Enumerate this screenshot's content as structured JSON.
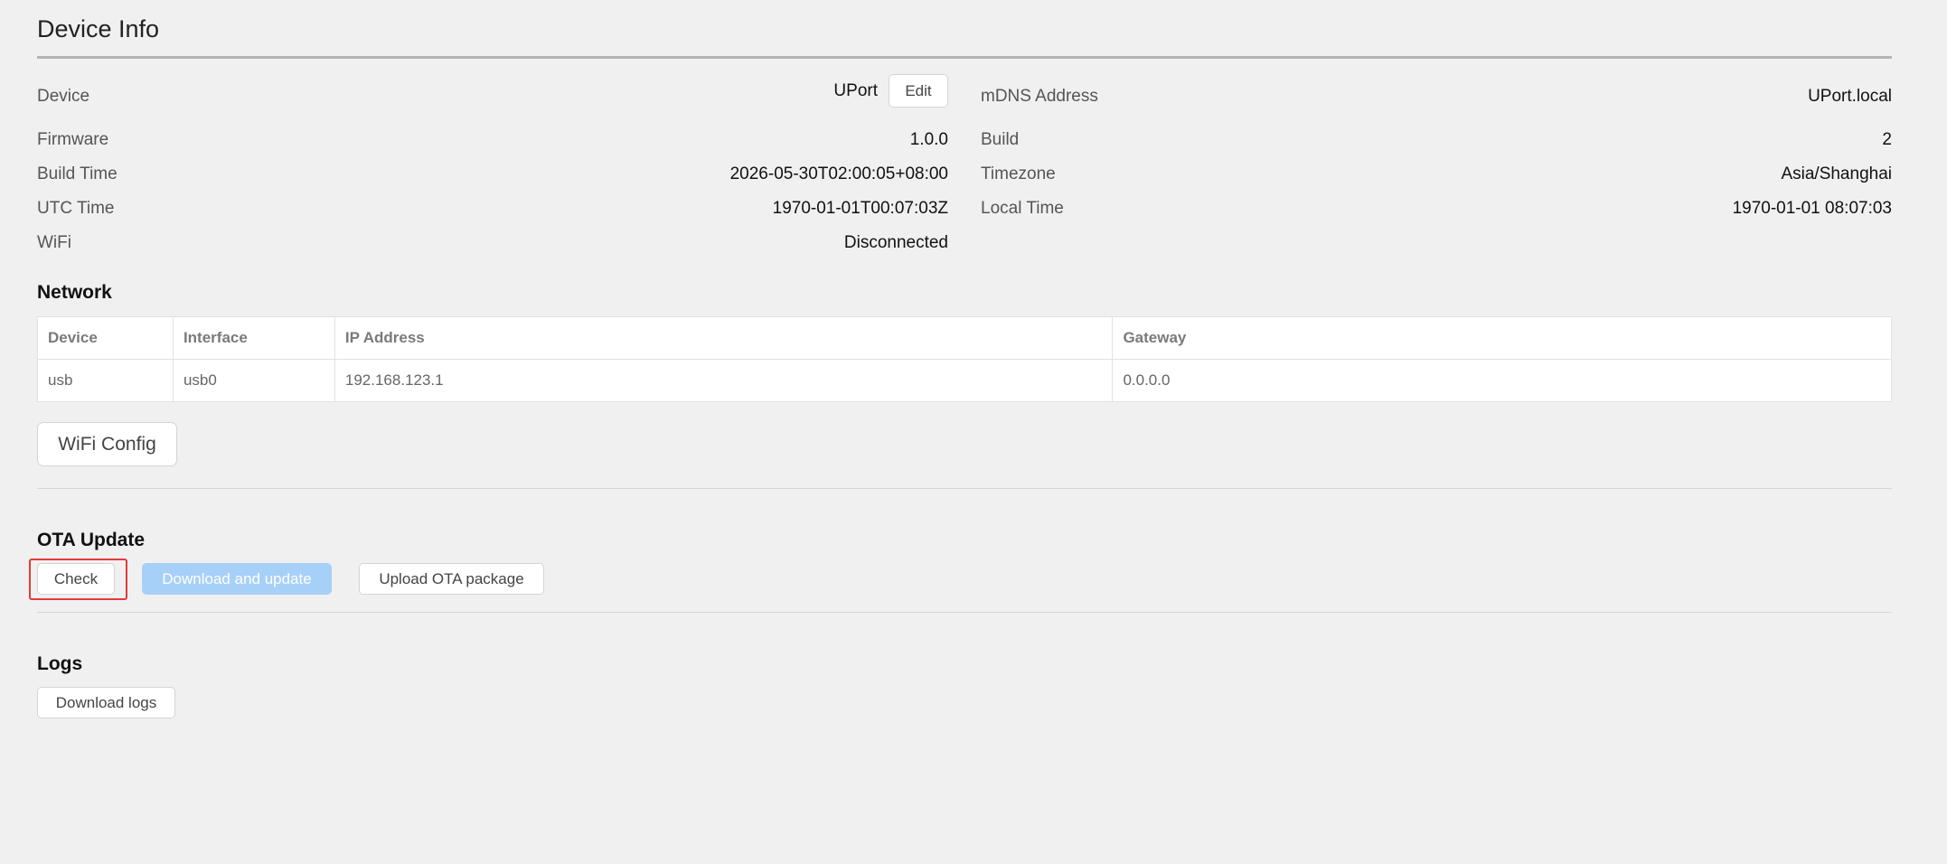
{
  "page": {
    "title": "Device Info"
  },
  "info": {
    "device": {
      "label": "Device",
      "value": "UPort",
      "edit_label": "Edit"
    },
    "mdns": {
      "label": "mDNS Address",
      "value": "UPort.local"
    },
    "firmware": {
      "label": "Firmware",
      "value": "1.0.0"
    },
    "build": {
      "label": "Build",
      "value": "2"
    },
    "build_time": {
      "label": "Build Time",
      "value": "2026-05-30T02:00:05+08:00"
    },
    "timezone": {
      "label": "Timezone",
      "value": "Asia/Shanghai"
    },
    "utc_time": {
      "label": "UTC Time",
      "value": "1970-01-01T00:07:03Z"
    },
    "local_time": {
      "label": "Local Time",
      "value": "1970-01-01 08:07:03"
    },
    "wifi": {
      "label": "WiFi",
      "value": "Disconnected"
    }
  },
  "network": {
    "title": "Network",
    "columns": [
      "Device",
      "Interface",
      "IP Address",
      "Gateway"
    ],
    "rows": [
      [
        "usb",
        "usb0",
        "192.168.123.1",
        "0.0.0.0"
      ]
    ],
    "wifi_config_label": "WiFi Config"
  },
  "ota": {
    "title": "OTA Update",
    "check_label": "Check",
    "download_update_label": "Download and update",
    "upload_label": "Upload OTA package"
  },
  "logs": {
    "title": "Logs",
    "download_label": "Download logs"
  },
  "colors": {
    "background": "#f0f0f0",
    "highlight_border": "#e23b3b",
    "disabled_primary": "#a6d0f7"
  }
}
